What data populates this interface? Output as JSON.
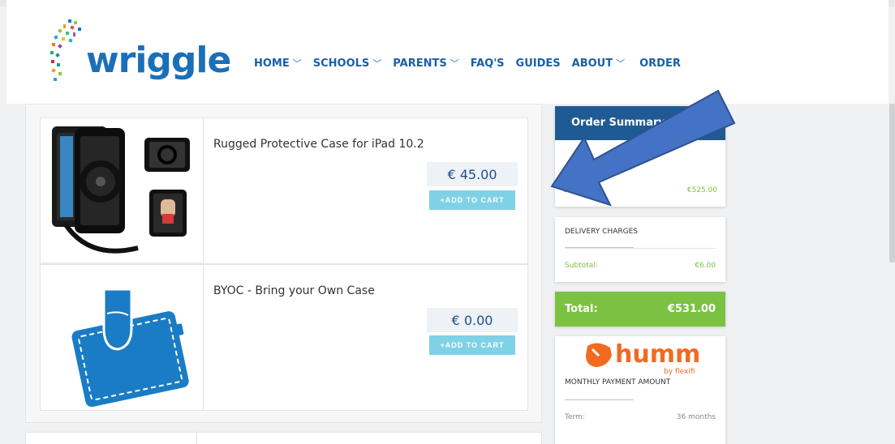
{
  "brand": {
    "logo_text": "wriggle"
  },
  "nav": {
    "items": [
      {
        "label": "HOME",
        "dropdown": true
      },
      {
        "label": "SCHOOLS",
        "dropdown": true
      },
      {
        "label": "PARENTS",
        "dropdown": true
      },
      {
        "label": "FAQ'S",
        "dropdown": false
      },
      {
        "label": "GUIDES",
        "dropdown": false
      },
      {
        "label": "ABOUT",
        "dropdown": true
      },
      {
        "label": "ORDER",
        "dropdown": false
      }
    ],
    "chevron": "﹀"
  },
  "products": [
    {
      "name": "Rugged Protective Case for iPad 10.2",
      "price": "€ 45.00",
      "cart_label": "+ADD TO CART",
      "image_icon": "rugged-case-image"
    },
    {
      "name": "BYOC - Bring your Own Case",
      "price": "€ 0.00",
      "cart_label": "+ADD TO CART",
      "image_icon": "byoc-case-image"
    }
  ],
  "sidebar": {
    "order_summary": {
      "title": "Order Summary",
      "subtotal_label": "Subtotal:",
      "subtotal_value": "€525.00"
    },
    "delivery": {
      "title": "DELIVERY CHARGES",
      "subtotal_label": "Subtotal:",
      "subtotal_value": "€6.00"
    },
    "total": {
      "label": "Total:",
      "value": "€531.00"
    },
    "humm": {
      "logo_text": "humm",
      "logo_sub": "by flexifi",
      "title": "MONTHLY PAYMENT AMOUNT",
      "term_label": "Term:",
      "term_value": "36 months"
    }
  },
  "colors": {
    "brand_blue": "#1b6fb8",
    "nav_blue": "#1b5fa8",
    "summary_header": "#1e5b94",
    "total_green": "#7cc242",
    "cart_button": "#7fd1e6",
    "humm_orange": "#f26a21",
    "arrow_blue": "#4472c4"
  },
  "annotation": {
    "icon": "pointer-arrow-icon"
  }
}
